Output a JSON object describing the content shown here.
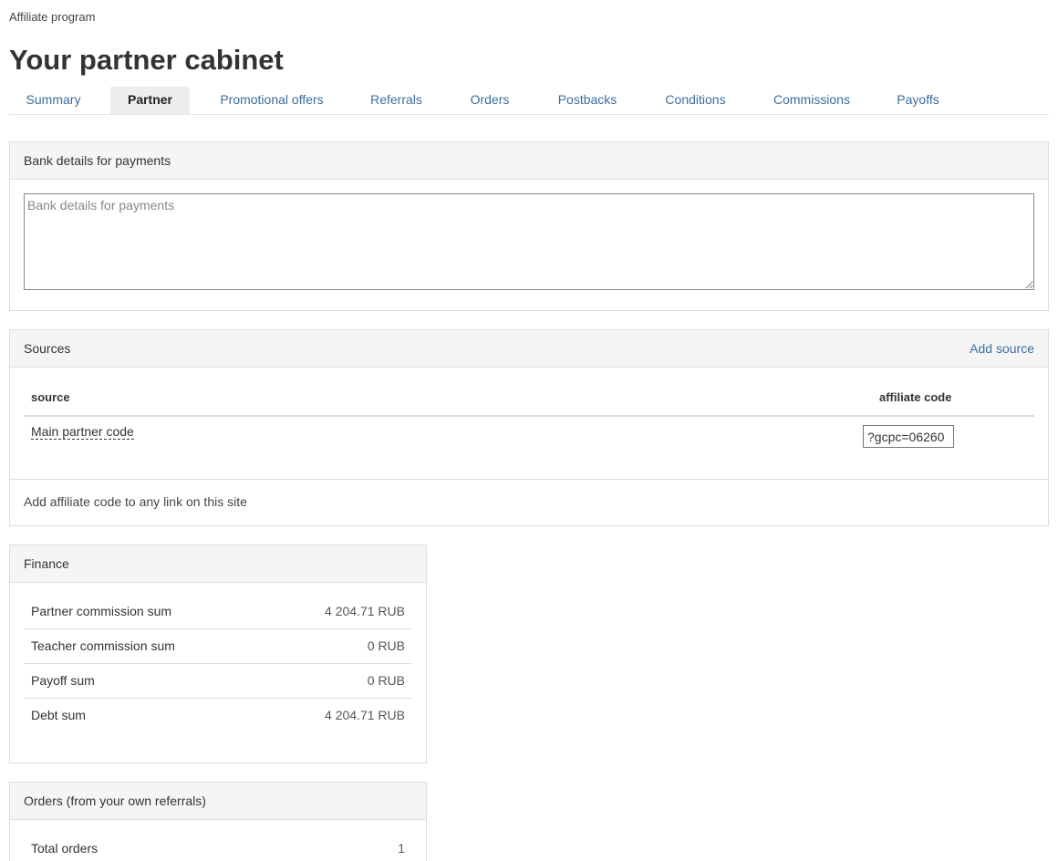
{
  "breadcrumb": "Affiliate program",
  "title": "Your partner cabinet",
  "tabs": [
    {
      "label": "Summary"
    },
    {
      "label": "Partner"
    },
    {
      "label": "Promotional offers"
    },
    {
      "label": "Referrals"
    },
    {
      "label": "Orders"
    },
    {
      "label": "Postbacks"
    },
    {
      "label": "Conditions"
    },
    {
      "label": "Commissions"
    },
    {
      "label": "Payoffs"
    }
  ],
  "active_tab": "Partner",
  "bank": {
    "heading": "Bank details for payments",
    "placeholder": "Bank details for payments",
    "value": ""
  },
  "sources": {
    "heading": "Sources",
    "add_link": "Add source",
    "columns": [
      "source",
      "affiliate code"
    ],
    "rows": [
      {
        "source": "Main partner code",
        "code": "?gcpc=06260"
      }
    ],
    "footer": "Add affiliate code to any link on this site"
  },
  "finance": {
    "heading": "Finance",
    "rows": [
      {
        "label": "Partner commission sum",
        "value": "4 204.71 RUB"
      },
      {
        "label": "Teacher commission sum",
        "value": "0 RUB"
      },
      {
        "label": "Payoff sum",
        "value": "0 RUB"
      },
      {
        "label": "Debt sum",
        "value": "4 204.71 RUB"
      }
    ]
  },
  "orders": {
    "heading": "Orders (from your own referrals)",
    "rows": [
      {
        "label": "Total orders",
        "value": "1"
      }
    ]
  },
  "colors": {
    "link": "#3c6e9f",
    "active_tab_bg": "#eeeeee",
    "panel_head_bg": "#f5f5f5",
    "border": "#dddddd"
  }
}
